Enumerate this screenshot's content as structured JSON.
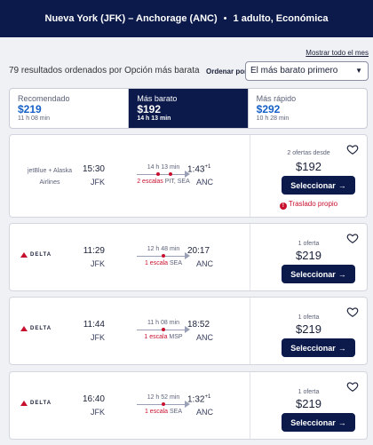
{
  "header": {
    "route": "Nueva York (JFK) – Anchorage (ANC)",
    "passengers": "1 adulto, Económica",
    "separator": "•"
  },
  "month_link": "Mostrar todo el mes",
  "results": {
    "count_text": "79 resultados ordenados por Opción más barata",
    "sort_label": "Ordenar por",
    "sort_value": "El más barato primero"
  },
  "tabs": [
    {
      "label": "Recomendado",
      "price": "$219",
      "duration": "11 h 08 min"
    },
    {
      "label": "Más barato",
      "price": "$192",
      "duration": "14 h 13 min"
    },
    {
      "label": "Más rápido",
      "price": "$292",
      "duration": "10 h 28 min"
    }
  ],
  "flights": [
    {
      "airline": "jetBlue + Alaska Airlines",
      "logo": "",
      "dep_time": "15:30",
      "dep_code": "JFK",
      "arr_time": "1:43",
      "arr_day": "+1",
      "arr_code": "ANC",
      "duration": "14 h 13 min",
      "stops": "2 escalas",
      "via": "PIT, SEA",
      "offers": "2 ofertas desde",
      "price": "$192",
      "button": "Seleccionar",
      "warning": "Traslado propio"
    },
    {
      "airline": "",
      "logo": "DELTA",
      "dep_time": "11:29",
      "dep_code": "JFK",
      "arr_time": "20:17",
      "arr_day": "",
      "arr_code": "ANC",
      "duration": "12 h 48 min",
      "stops": "1 escala",
      "via": "SEA",
      "offers": "1 oferta",
      "price": "$219",
      "button": "Seleccionar",
      "warning": ""
    },
    {
      "airline": "",
      "logo": "DELTA",
      "dep_time": "11:44",
      "dep_code": "JFK",
      "arr_time": "18:52",
      "arr_day": "",
      "arr_code": "ANC",
      "duration": "11 h 08 min",
      "stops": "1 escala",
      "via": "MSP",
      "offers": "1 oferta",
      "price": "$219",
      "button": "Seleccionar",
      "warning": ""
    },
    {
      "airline": "",
      "logo": "DELTA",
      "dep_time": "16:40",
      "dep_code": "JFK",
      "arr_time": "1:32",
      "arr_day": "+1",
      "arr_code": "ANC",
      "duration": "12 h 52 min",
      "stops": "1 escala",
      "via": "SEA",
      "offers": "1 oferta",
      "price": "$219",
      "button": "Seleccionar",
      "warning": ""
    }
  ],
  "colors": {
    "navy": "#0b1a4a",
    "accent_blue": "#1560c7",
    "alert_red": "#c8102e"
  }
}
